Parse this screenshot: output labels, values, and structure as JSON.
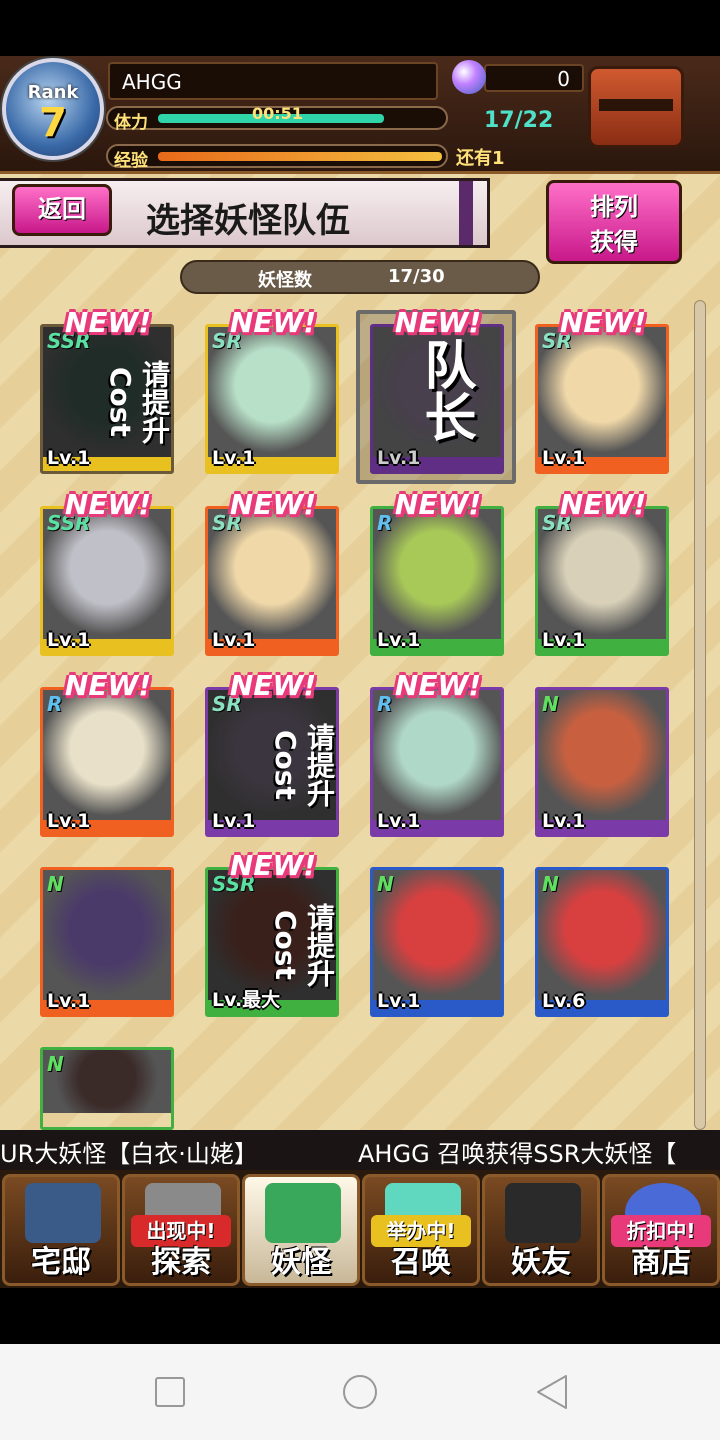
{
  "header": {
    "rank_label": "Rank",
    "rank_value": "7",
    "player_name": "AHGG",
    "stamina_label": "体力",
    "stamina_timer": "00:51",
    "stamina_count": "17/22",
    "exp_label": "经验",
    "exp_remaining": "还有1",
    "gem_count": "0"
  },
  "page": {
    "back_label": "返回",
    "title": "选择妖怪队伍",
    "sort_label_1": "排列",
    "sort_label_2": "获得",
    "count_label": "妖怪数",
    "count_value": "17/30"
  },
  "cards": [
    {
      "level": "Lv.1",
      "rarity": "SSR",
      "new": "NEW!",
      "overlay": "请提升Cost"
    },
    {
      "level": "Lv.1",
      "rarity": "SR",
      "new": "NEW!",
      "overlay": ""
    },
    {
      "level": "Lv.1",
      "rarity": "",
      "new": "NEW!",
      "overlay": "",
      "leader": "队长"
    },
    {
      "level": "Lv.1",
      "rarity": "SR",
      "new": "NEW!",
      "overlay": ""
    },
    {
      "level": "Lv.1",
      "rarity": "SSR",
      "new": "NEW!",
      "overlay": ""
    },
    {
      "level": "Lv.1",
      "rarity": "SR",
      "new": "NEW!",
      "overlay": ""
    },
    {
      "level": "Lv.1",
      "rarity": "R",
      "new": "NEW!",
      "overlay": ""
    },
    {
      "level": "Lv.1",
      "rarity": "SR",
      "new": "NEW!",
      "overlay": ""
    },
    {
      "level": "Lv.1",
      "rarity": "R",
      "new": "NEW!",
      "overlay": ""
    },
    {
      "level": "Lv.1",
      "rarity": "SR",
      "new": "NEW!",
      "overlay": "请提升Cost"
    },
    {
      "level": "Lv.1",
      "rarity": "R",
      "new": "NEW!",
      "overlay": ""
    },
    {
      "level": "Lv.1",
      "rarity": "N",
      "new": "",
      "overlay": ""
    },
    {
      "level": "Lv.1",
      "rarity": "N",
      "new": "",
      "overlay": ""
    },
    {
      "level": "Lv.最大",
      "rarity": "SSR",
      "new": "NEW!",
      "overlay": "请提升Cost"
    },
    {
      "level": "Lv.1",
      "rarity": "N",
      "new": "",
      "overlay": ""
    },
    {
      "level": "Lv.6",
      "rarity": "N",
      "new": "",
      "overlay": ""
    },
    {
      "level": "",
      "rarity": "N",
      "new": "",
      "overlay": ""
    }
  ],
  "ticker": {
    "part1": "UR大妖怪【白衣·山姥】",
    "part2": "AHGG 召唤获得SSR大妖怪【"
  },
  "nav": [
    {
      "label": "宅邸",
      "badge": ""
    },
    {
      "label": "探索",
      "badge": "出现中!"
    },
    {
      "label": "妖怪",
      "badge": ""
    },
    {
      "label": "召唤",
      "badge": "举办中!"
    },
    {
      "label": "妖友",
      "badge": ""
    },
    {
      "label": "商店",
      "badge": "折扣中!"
    }
  ],
  "colors": {
    "accent_pink": "#e83a7a",
    "stamina": "#2fd4a8",
    "rarity_gold": "#e8c020",
    "rarity_orange": "#f06020",
    "rarity_green": "#40b040",
    "rarity_purple": "#7a3aa8",
    "rarity_blue": "#2a5ac8"
  }
}
